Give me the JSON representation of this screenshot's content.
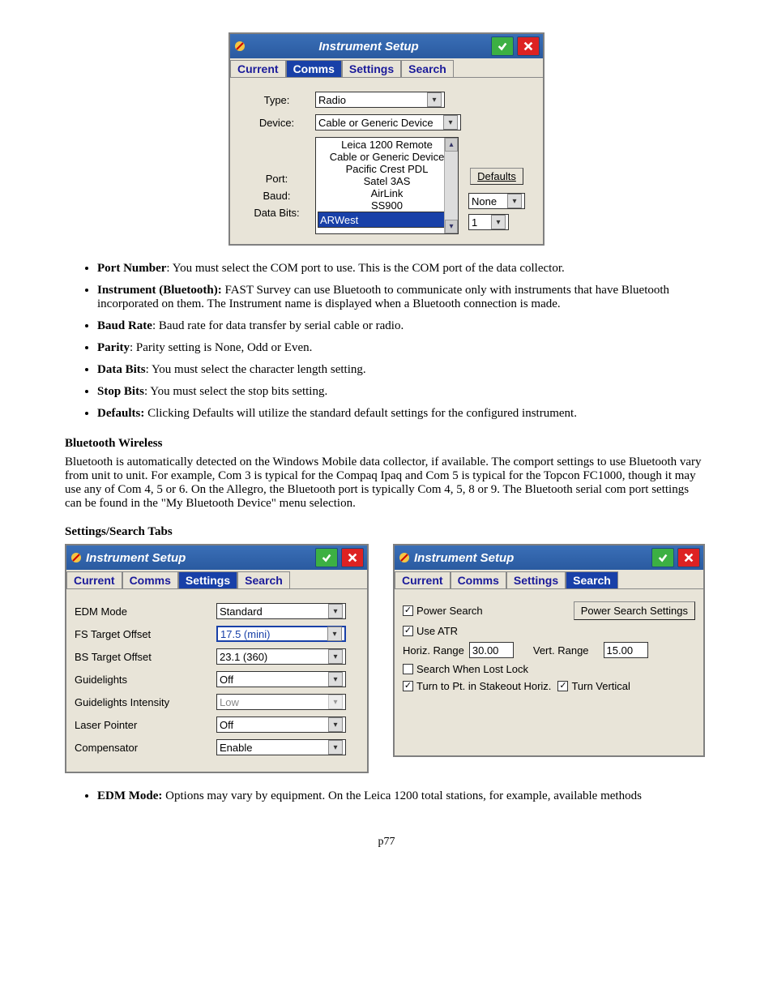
{
  "comms": {
    "title": "Instrument Setup",
    "tabs": [
      "Current",
      "Comms",
      "Settings",
      "Search"
    ],
    "activeTab": 1,
    "type_label": "Type:",
    "type_value": "Radio",
    "device_label": "Device:",
    "device_value": "Cable or Generic Device",
    "port_label": "Port:",
    "baud_label": "Baud:",
    "databits_label": "Data Bits:",
    "defaults_btn": "Defaults",
    "none_value": "None",
    "one_value": "1",
    "dropdown_items": [
      "Leica 1200 Remote",
      "Cable or Generic Device",
      "Pacific Crest PDL",
      "Satel 3AS",
      "AirLink",
      "SS900",
      "ARWest"
    ],
    "dropdown_selected": 6
  },
  "bullets1": [
    {
      "t": "Port Number",
      "d": ":  You must select the COM port to use. This is the COM port of the data collector."
    },
    {
      "t": "Instrument (Bluetooth):",
      "d": "   FAST Survey can use Bluetooth to communicate only with instruments that have Bluetooth                    incorporated on them. The Instrument name is displayed when a Bluetooth connection is made."
    },
    {
      "t": "Baud Rate",
      "d": ":  Baud rate for data transfer by serial cable or radio."
    },
    {
      "t": "Parity",
      "d": ":  Parity setting is None, Odd or Even."
    },
    {
      "t": "Data Bits",
      "d": ":  You must select the character length setting."
    },
    {
      "t": "Stop Bits",
      "d": ":  You must select the stop bits setting."
    },
    {
      "t": "Defaults:",
      "d": " Clicking Defaults will utilize the standard default settings for the configured instrument."
    }
  ],
  "bt_heading": "Bluetooth Wireless",
  "bt_para": "Bluetooth is automatically detected on the Windows Mobile data collector, if available.  The comport settings to use Bluetooth vary from unit to unit.  For example, Com 3 is typical for the Compaq Ipaq and Com 5 is typical for the Topcon FC1000, though it may use any of Com 4, 5 or 6.  On the Allegro, the Bluetooth port is typically Com 4, 5, 8 or 9.  The Bluetooth serial com port settings can be found in the \"My Bluetooth Device\" menu selection.",
  "ss_heading": "Settings/Search Tabs",
  "settings": {
    "title": "Instrument Setup",
    "tabs": [
      "Current",
      "Comms",
      "Settings",
      "Search"
    ],
    "activeTab": 2,
    "rows": [
      {
        "l": "EDM Mode",
        "v": "Standard",
        "hl": false
      },
      {
        "l": "FS Target Offset",
        "v": "17.5 (mini)",
        "hl": true
      },
      {
        "l": "BS Target Offset",
        "v": "23.1 (360)",
        "hl": false
      },
      {
        "l": "Guidelights",
        "v": "Off",
        "hl": false
      },
      {
        "l": "Guidelights Intensity",
        "v": "Low",
        "hl": false,
        "dis": true
      },
      {
        "l": "Laser Pointer",
        "v": "Off",
        "hl": false
      },
      {
        "l": "Compensator",
        "v": "Enable",
        "hl": false
      }
    ]
  },
  "search": {
    "title": "Instrument Setup",
    "tabs": [
      "Current",
      "Comms",
      "Settings",
      "Search"
    ],
    "activeTab": 3,
    "power_search": "Power Search",
    "power_btn": "Power Search Settings",
    "use_atr": "Use ATR",
    "horiz_lbl": "Horiz. Range",
    "horiz_val": "30.00",
    "vert_lbl": "Vert. Range",
    "vert_val": "15.00",
    "lost": "Search When Lost Lock",
    "turn_horiz": "Turn to Pt. in Stakeout Horiz.",
    "turn_vert": "Turn Vertical"
  },
  "bullets2": [
    {
      "t": "EDM Mode:",
      "d": "   Options may vary by equipment.  On the Leica 1200 total stations, for example, available methods"
    }
  ],
  "page": "p77"
}
